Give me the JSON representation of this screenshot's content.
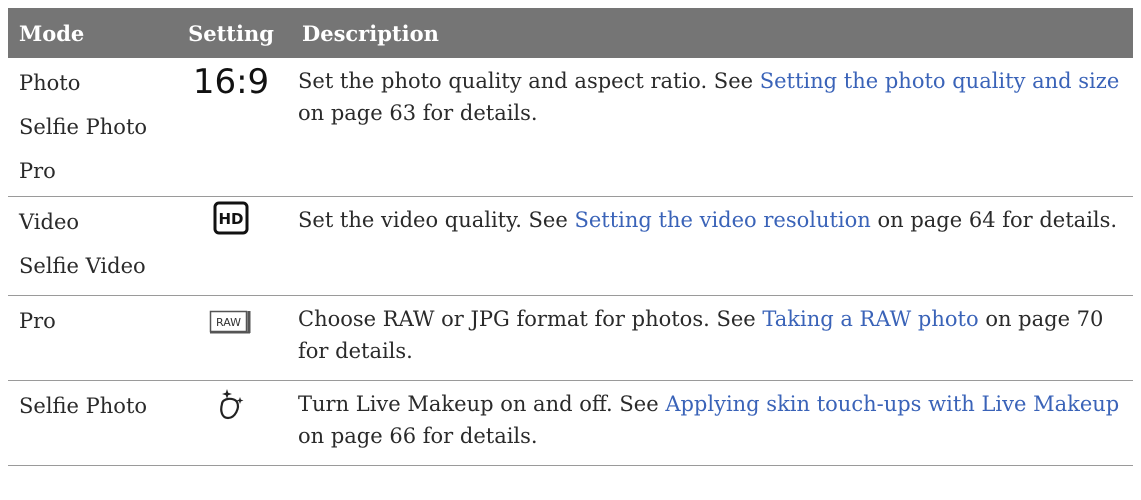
{
  "table": {
    "headers": {
      "mode": "Mode",
      "setting": "Setting",
      "description": "Description"
    },
    "rows": [
      {
        "modes": [
          "Photo",
          "Selfie Photo",
          "Pro"
        ],
        "setting_text": "16:9",
        "setting_icon": "aspect-ratio-16-9-icon",
        "desc_before": "Set the photo quality and aspect ratio. See ",
        "link": "Setting the photo quality and size",
        "desc_after": " on page 63 for details."
      },
      {
        "modes": [
          "Video",
          "Selfie Video"
        ],
        "setting_text": "HD",
        "setting_icon": "hd-video-icon",
        "desc_before": "Set the video quality. See ",
        "link": "Setting the video resolution",
        "desc_after": " on page 64 for details."
      },
      {
        "modes": [
          "Pro"
        ],
        "setting_text": "RAW",
        "setting_icon": "raw-format-icon",
        "desc_before": "Choose RAW or JPG format for photos. See ",
        "link": "Taking a RAW photo",
        "desc_after": " on page 70 for details."
      },
      {
        "modes": [
          "Selfie Photo"
        ],
        "setting_icon": "live-makeup-icon",
        "desc_before": "Turn Live Makeup on and off. See ",
        "link": "Applying skin touch-ups with Live Makeup",
        "desc_after": " on page 66 for details."
      }
    ]
  },
  "colors": {
    "header_bg": "#757575",
    "header_text": "#ffffff",
    "link": "#3a63b8",
    "body_text": "#2a2a2a",
    "divider": "#9a9a9a"
  }
}
